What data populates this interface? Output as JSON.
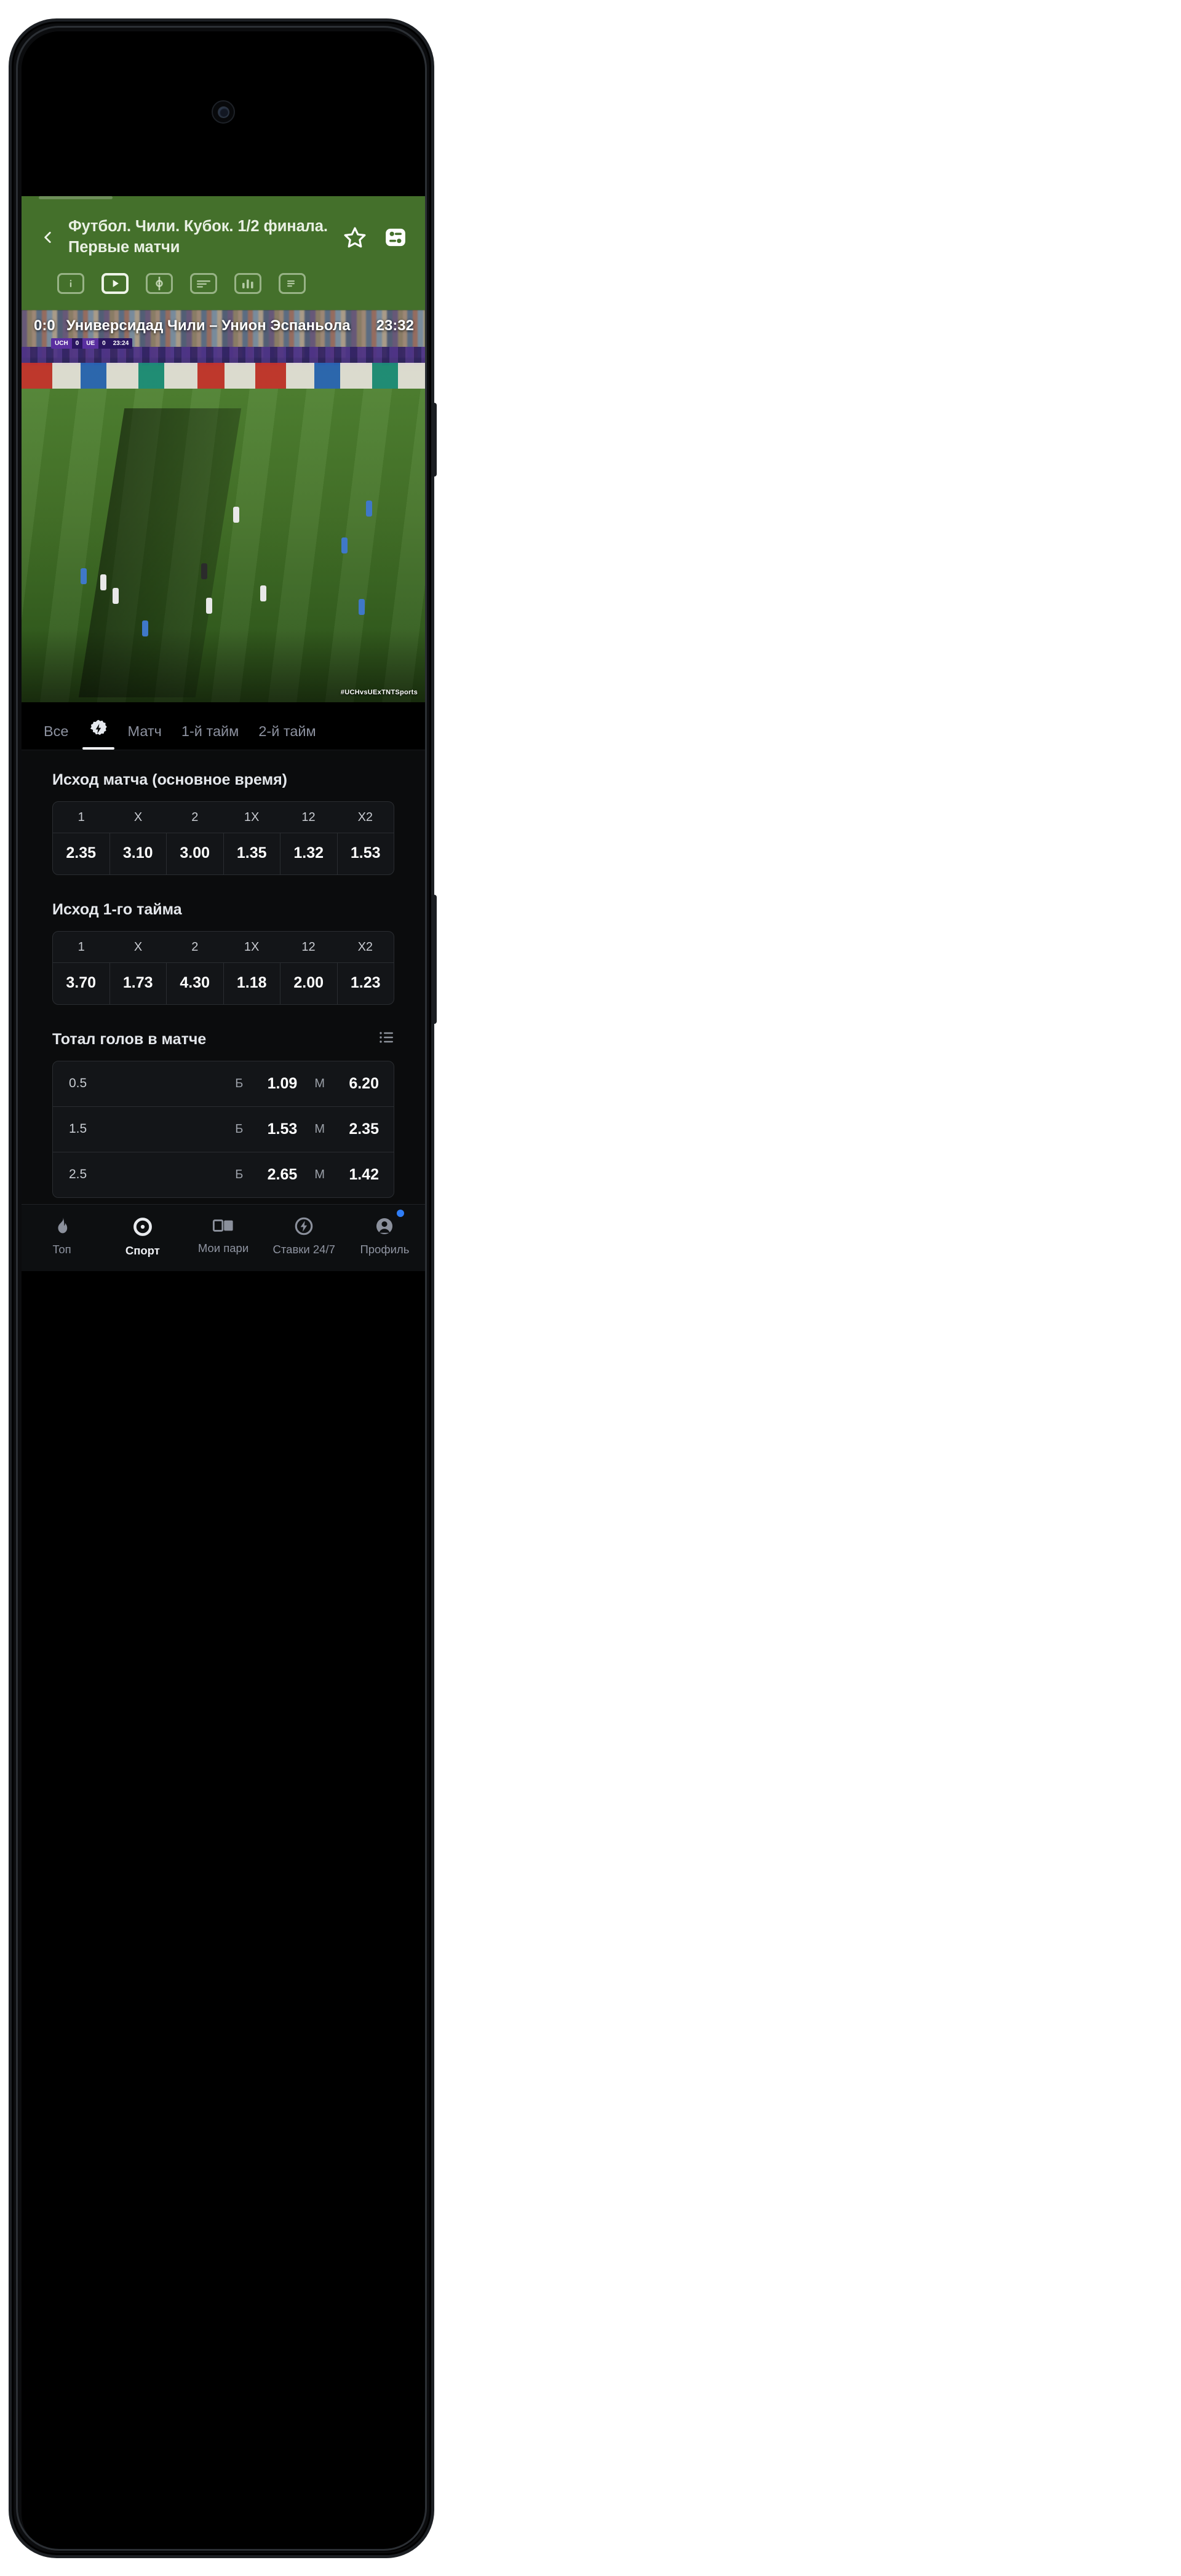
{
  "header": {
    "title": "Футбол. Чили. Кубок. 1/2 финала. Первые матчи",
    "back_icon": "chevron-left-icon",
    "favorite_icon": "star-icon",
    "settings_icon": "toggles-icon",
    "accent_color": "#44702b",
    "icon_tabs": [
      {
        "name": "info-icon",
        "label": "i",
        "active": false
      },
      {
        "name": "video-icon",
        "label": "play",
        "active": true
      },
      {
        "name": "field-icon",
        "label": "field",
        "active": false
      },
      {
        "name": "lineup-icon",
        "label": "lineup",
        "active": false
      },
      {
        "name": "stats-icon",
        "label": "stats",
        "active": false
      },
      {
        "name": "review-icon",
        "label": "review",
        "active": false
      }
    ]
  },
  "video": {
    "score": "0:0",
    "teams": "Универсидад Чили – Унион Эспаньола",
    "time": "23:32",
    "watermark": "#UCHvsUExTNTSports",
    "overlay_home": "UCH",
    "overlay_home_score": "0",
    "overlay_away": "UE",
    "overlay_away_score": "0",
    "overlay_clock": "23:24"
  },
  "market_tabs": [
    {
      "label": "Все",
      "active": false,
      "icon": null
    },
    {
      "label": "",
      "active": true,
      "icon": "lightning-badge-icon"
    },
    {
      "label": "Матч",
      "active": false,
      "icon": null
    },
    {
      "label": "1-й тайм",
      "active": false,
      "icon": null
    },
    {
      "label": "2-й тайм",
      "active": false,
      "icon": null
    }
  ],
  "markets": [
    {
      "title": "Исход матча (основное время)",
      "type": "outcome",
      "columns": [
        "1",
        "X",
        "2",
        "1X",
        "12",
        "X2"
      ],
      "odds": [
        "2.35",
        "3.10",
        "3.00",
        "1.35",
        "1.32",
        "1.53"
      ]
    },
    {
      "title": "Исход 1-го тайма",
      "type": "outcome",
      "columns": [
        "1",
        "X",
        "2",
        "1X",
        "12",
        "X2"
      ],
      "odds": [
        "3.70",
        "1.73",
        "4.30",
        "1.18",
        "2.00",
        "1.23"
      ]
    }
  ],
  "totals": {
    "title": "Тотал голов в матче",
    "list_icon": "list-view-icon",
    "over_label": "Б",
    "under_label": "М",
    "rows": [
      {
        "line": "0.5",
        "over": "1.09",
        "under": "6.20"
      },
      {
        "line": "1.5",
        "over": "1.53",
        "under": "2.35"
      },
      {
        "line": "2.5",
        "over": "2.65",
        "under": "1.42"
      }
    ]
  },
  "bottom_nav": {
    "items": [
      {
        "label": "Топ",
        "icon": "flame-icon",
        "active": false,
        "badge": false
      },
      {
        "label": "Спорт",
        "icon": "target-icon",
        "active": true,
        "badge": false
      },
      {
        "label": "Мои пари",
        "icon": "ticket-icon",
        "active": false,
        "badge": false
      },
      {
        "label": "Ставки 24/7",
        "icon": "lightning-circle-icon",
        "active": false,
        "badge": false
      },
      {
        "label": "Профиль",
        "icon": "person-icon",
        "active": false,
        "badge": true
      }
    ],
    "badge_color": "#2f7df6"
  }
}
